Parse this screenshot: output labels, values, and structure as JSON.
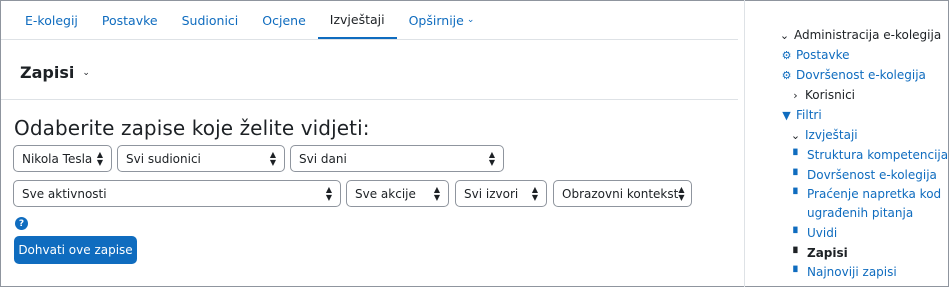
{
  "tabs": [
    {
      "label": "E-kolegij"
    },
    {
      "label": "Postavke"
    },
    {
      "label": "Sudionici"
    },
    {
      "label": "Ocjene"
    },
    {
      "label": "Izvještaji"
    },
    {
      "label": "Opširnije"
    }
  ],
  "page": {
    "title": "Zapisi",
    "heading": "Odaberite zapise koje želite vidjeti:"
  },
  "filters": {
    "user": "Nikola Tesla",
    "participants": "Svi sudionici",
    "days": "Svi dani",
    "activities": "Sve aktivnosti",
    "actions": "Sve akcije",
    "sources": "Svi izvori",
    "context": "Obrazovni kontekst"
  },
  "help_icon": "?",
  "submit_label": "Dohvati ove zapise",
  "sidebar": {
    "admin": "Administracija e-kolegija",
    "settings": "Postavke",
    "completion": "Dovršenost e-kolegija",
    "users": "Korisnici",
    "filters": "Filtri",
    "reports": "Izvještaji",
    "items": [
      {
        "label": "Struktura kompetencija"
      },
      {
        "label": "Dovršenost e-kolegija"
      },
      {
        "label": "Praćenje napretka kod"
      },
      {
        "label": "ugrađenih pitanja"
      },
      {
        "label": "Uvidi"
      },
      {
        "label": "Zapisi"
      },
      {
        "label": "Najnoviji zapisi"
      }
    ]
  },
  "colors": {
    "accent": "#0f6cbf",
    "text": "#1d2125",
    "border": "#8f959e"
  }
}
